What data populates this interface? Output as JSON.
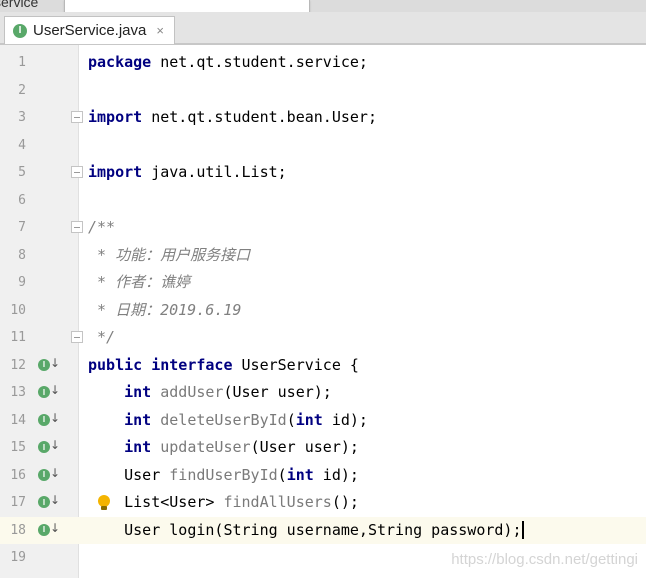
{
  "window": {
    "crumb_text": "service"
  },
  "tab": {
    "icon_letter": "I",
    "label": "UserService.java",
    "close_glyph": "×"
  },
  "colors": {
    "keyword": "#000080",
    "comment": "#808080",
    "method_decl": "#7a7a7a",
    "gutter": "#f0f0f0",
    "current_line": "#fcfaed",
    "interface_icon": "#59a869"
  },
  "editor": {
    "current_line": 18,
    "lines": [
      {
        "no": "1",
        "segments": [
          {
            "t": "package",
            "c": "kw"
          },
          {
            "t": " net.qt.student.service;",
            "c": ""
          }
        ]
      },
      {
        "no": "2",
        "segments": []
      },
      {
        "no": "3",
        "fold": true,
        "segments": [
          {
            "t": "import",
            "c": "kw"
          },
          {
            "t": " net.qt.student.bean.User;",
            "c": ""
          }
        ]
      },
      {
        "no": "4",
        "segments": []
      },
      {
        "no": "5",
        "fold": true,
        "segments": [
          {
            "t": "import",
            "c": "kw"
          },
          {
            "t": " java.util.List;",
            "c": ""
          }
        ]
      },
      {
        "no": "6",
        "segments": []
      },
      {
        "no": "7",
        "fold": true,
        "segments": [
          {
            "t": "/**",
            "c": "comment"
          }
        ]
      },
      {
        "no": "8",
        "segments": [
          {
            "t": " * 功能：用户服务接口",
            "c": "comment"
          }
        ]
      },
      {
        "no": "9",
        "segments": [
          {
            "t": " * 作者：谯婷",
            "c": "comment"
          }
        ]
      },
      {
        "no": "10",
        "segments": [
          {
            "t": " * 日期：2019.6.19",
            "c": "comment"
          }
        ]
      },
      {
        "no": "11",
        "fold": true,
        "segments": [
          {
            "t": " */",
            "c": "comment"
          }
        ]
      },
      {
        "no": "12",
        "impl": true,
        "segments": [
          {
            "t": "public",
            "c": "kw"
          },
          {
            "t": " ",
            "c": ""
          },
          {
            "t": "interface",
            "c": "kw"
          },
          {
            "t": " UserService {",
            "c": ""
          }
        ]
      },
      {
        "no": "13",
        "impl": true,
        "segments": [
          {
            "t": "    ",
            "c": ""
          },
          {
            "t": "int",
            "c": "kw"
          },
          {
            "t": " ",
            "c": ""
          },
          {
            "t": "addUser",
            "c": "method"
          },
          {
            "t": "(User user);",
            "c": ""
          }
        ]
      },
      {
        "no": "14",
        "impl": true,
        "segments": [
          {
            "t": "    ",
            "c": ""
          },
          {
            "t": "int",
            "c": "kw"
          },
          {
            "t": " ",
            "c": ""
          },
          {
            "t": "deleteUserById",
            "c": "method"
          },
          {
            "t": "(",
            "c": ""
          },
          {
            "t": "int",
            "c": "kw"
          },
          {
            "t": " id);",
            "c": ""
          }
        ]
      },
      {
        "no": "15",
        "impl": true,
        "segments": [
          {
            "t": "    ",
            "c": ""
          },
          {
            "t": "int",
            "c": "kw"
          },
          {
            "t": " ",
            "c": ""
          },
          {
            "t": "updateUser",
            "c": "method"
          },
          {
            "t": "(User user);",
            "c": ""
          }
        ]
      },
      {
        "no": "16",
        "impl": true,
        "segments": [
          {
            "t": "    User ",
            "c": ""
          },
          {
            "t": "findUserById",
            "c": "method"
          },
          {
            "t": "(",
            "c": ""
          },
          {
            "t": "int",
            "c": "kw"
          },
          {
            "t": " id);",
            "c": ""
          }
        ]
      },
      {
        "no": "17",
        "impl": true,
        "bulb": true,
        "segments": [
          {
            "t": "    List<User> ",
            "c": ""
          },
          {
            "t": "findAllUsers",
            "c": "method"
          },
          {
            "t": "();",
            "c": ""
          }
        ]
      },
      {
        "no": "18",
        "impl": true,
        "caret": true,
        "segments": [
          {
            "t": "    User login(String username,String password);",
            "c": ""
          }
        ]
      },
      {
        "no": "19",
        "segments": []
      }
    ]
  },
  "watermark": "https://blog.csdn.net/gettingi"
}
